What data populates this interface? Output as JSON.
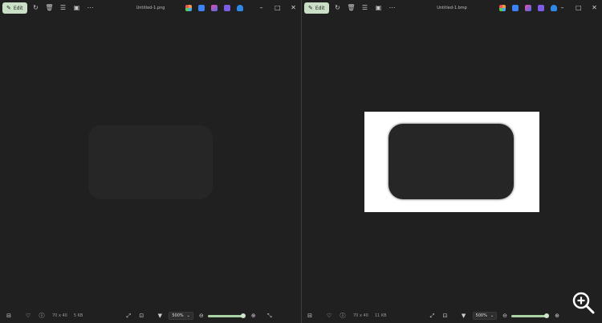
{
  "left_window": {
    "edit_label": "Edit",
    "title": "Untitled-1.png",
    "status": {
      "dimensions": "70 x 40",
      "file_size": "5 KB",
      "zoom": "500%",
      "zoom_level": 0.95
    }
  },
  "right_window": {
    "edit_label": "Edit",
    "title": "Untitled-1.bmp",
    "status": {
      "dimensions": "70 x 40",
      "file_size": "11 KB",
      "zoom": "500%",
      "zoom_level": 0.95
    }
  },
  "colors": {
    "background": "#202020",
    "accent": "#a9d3a4",
    "edit_button": "#c9dfc6",
    "image_white": "#ffffff",
    "shape_dark": "#262626"
  },
  "icons": {
    "toolbar": [
      "rotate-icon",
      "delete-icon",
      "adjust-icon",
      "slideshow-icon",
      "more-icon"
    ],
    "app_shortcuts": [
      "photos-app-icon",
      "ai-app-icon",
      "edit-app-icon",
      "clipchamp-icon",
      "onedrive-icon"
    ],
    "window": [
      "minimize-icon",
      "maximize-icon",
      "close-icon"
    ]
  }
}
